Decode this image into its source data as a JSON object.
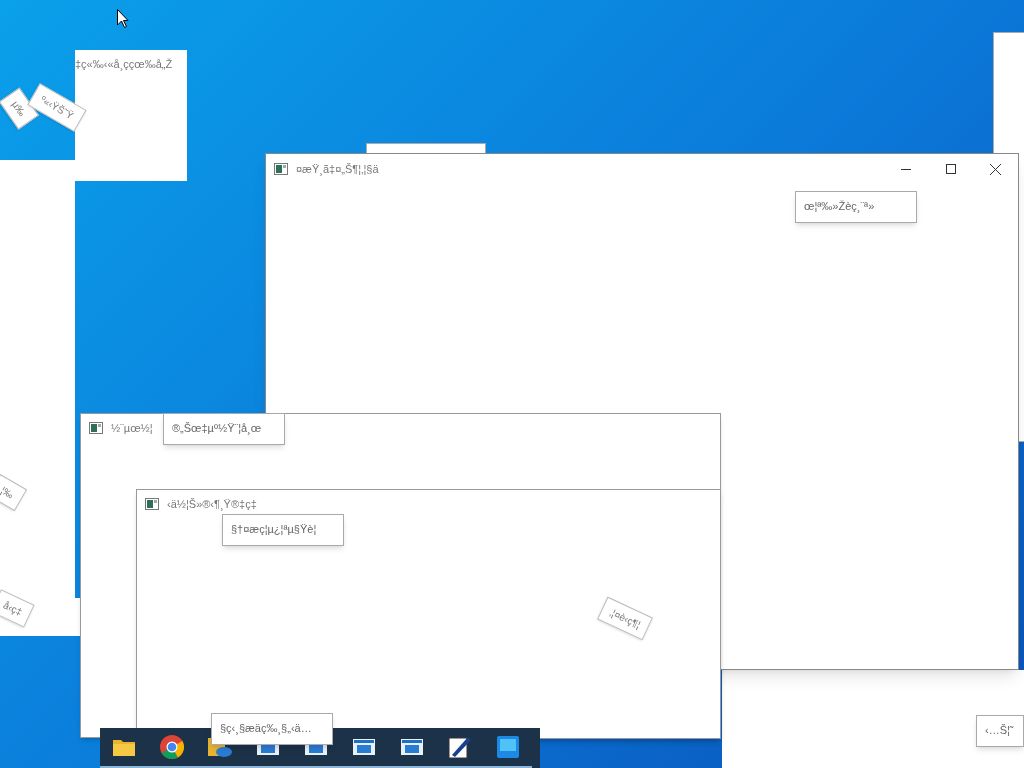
{
  "windows": [
    {
      "kind": "card",
      "title": "‡ç«‰‹«å¸ççœ‰å„Ž"
    },
    {
      "kind": "main",
      "title": "¤æŸ¸ã‡¤„Š¶¦‚¦§ä",
      "tooltip": "œ¦ª‰»Žèç¸¨ª»"
    },
    {
      "kind": "back",
      "title": "½¨µœ½¦",
      "tooltip": "®„Šœ‡µº½Ÿ¨¦å¸œ"
    },
    {
      "kind": "front",
      "title": "‹ä½¦Š»®‹¶¸Ÿ®‡ç‡",
      "tooltip": "§†¤æç¦µ¿¦ªµ§Ÿè¦"
    }
  ],
  "fragments": [
    "µ‰",
    "º«‹ŸŠ˜Ÿ",
    "¦‰",
    "å‹ç‡",
    "‚¦¤è‹ç¶¦"
  ],
  "taskbar": {
    "items": [
      {
        "kind": "folder"
      },
      {
        "kind": "chrome"
      },
      {
        "kind": "cloud-folder"
      },
      {
        "kind": "window"
      },
      {
        "kind": "window"
      },
      {
        "kind": "window"
      },
      {
        "kind": "window"
      },
      {
        "kind": "pen"
      },
      {
        "kind": "app"
      }
    ],
    "tooltip": "§ç‹¸§æäç‰¸§„‹ä…"
  },
  "corner_tooltip": "‹…Š¦˜"
}
